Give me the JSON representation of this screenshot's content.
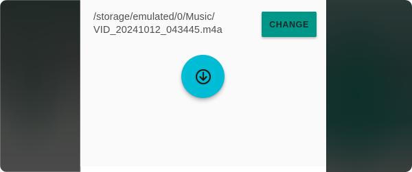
{
  "recording": {
    "file_path": "/storage/emulated/0/Music/\nVID_20241012_043445.m4a"
  },
  "actions": {
    "change_label": "CHANGE",
    "download_icon": "download-circle-icon"
  },
  "colors": {
    "change_button": "#009688",
    "download_button": "#00bcd4",
    "panel": "#fafafa"
  }
}
